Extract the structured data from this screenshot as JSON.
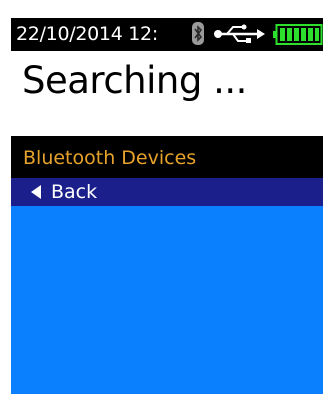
{
  "status_bar": {
    "datetime": "22/10/2014  12:",
    "icons": [
      "bluetooth-icon",
      "usb-icon",
      "battery-icon"
    ],
    "battery_level": 1.0
  },
  "header": {
    "title": "Searching ..."
  },
  "section": {
    "label": "Bluetooth Devices"
  },
  "list": {
    "items": [
      {
        "label": "Back",
        "icon": "back-arrow-icon"
      }
    ]
  },
  "colors": {
    "screen_bg": "#000000",
    "title_bg": "#ffffff",
    "section_label": "#e6a22a",
    "list_bg": "#0a80ff",
    "selected_row": "#1a1f8c",
    "battery": "#2de02d"
  }
}
